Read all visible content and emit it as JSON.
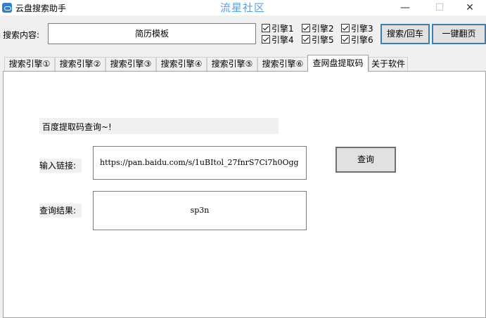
{
  "window": {
    "title": "云盘搜索助手",
    "watermark": "流星社区",
    "minimize": "—",
    "maximize": "☐",
    "close": "✕"
  },
  "search": {
    "label": "搜索内容:",
    "value": "简历模板",
    "engines": [
      "引擎1",
      "引擎2",
      "引擎3",
      "引擎4",
      "引擎5",
      "引擎6"
    ],
    "search_button": "搜索/回车",
    "page_button": "一键翻页"
  },
  "tabs": [
    "搜索引擎①",
    "搜索引擎②",
    "搜索引擎③",
    "搜索引擎④",
    "搜索引擎⑤",
    "搜索引擎⑥",
    "查网盘提取码",
    "关于软件"
  ],
  "active_tab": 6,
  "panel": {
    "heading": "百度提取码查询~!",
    "link_label": "输入链接:",
    "link_value": "https://pan.baidu.com/s/1uBItol_27fnrS7Ci7h0Ogg",
    "query_button": "查询",
    "result_label": "查询结果:",
    "result_value": "sp3n"
  }
}
